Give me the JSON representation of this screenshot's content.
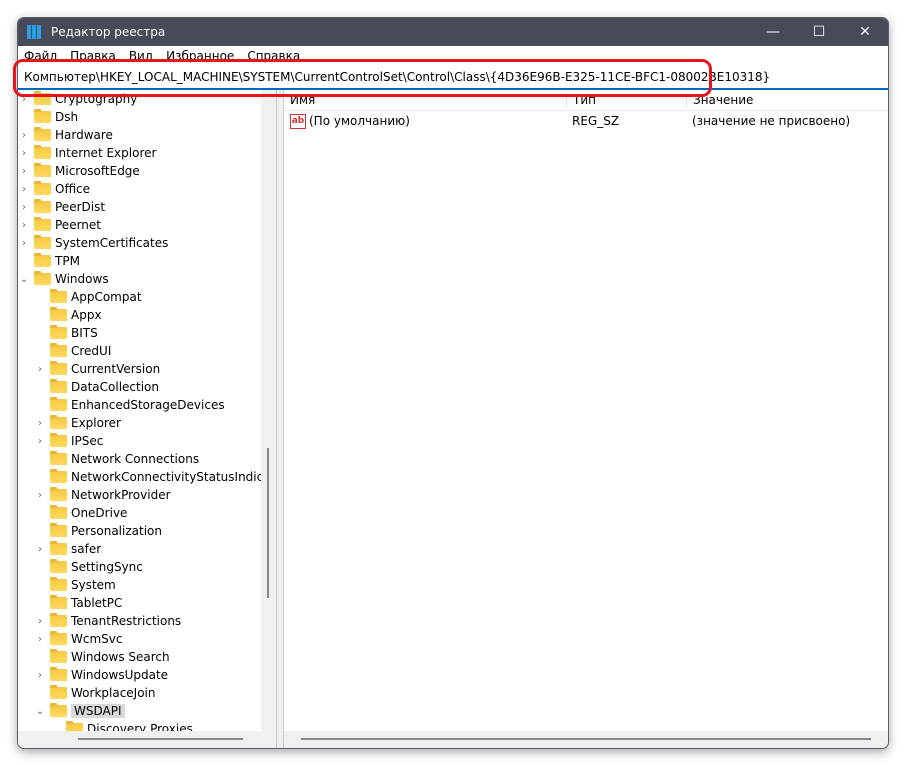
{
  "window": {
    "title": "Редактор реестра",
    "minimize": "—",
    "maximize": "☐",
    "close": "✕"
  },
  "menu": [
    "Файл",
    "Правка",
    "Вид",
    "Избранное",
    "Справка"
  ],
  "address": "Компьютер\\HKEY_LOCAL_MACHINE\\SYSTEM\\CurrentControlSet\\Control\\Class\\{4D36E96B-E325-11CE-BFC1-08002BE10318}",
  "tree": [
    {
      "label": "Cryptography",
      "level": 0,
      "expander": "collapsed"
    },
    {
      "label": "Dsh",
      "level": 0,
      "expander": "none"
    },
    {
      "label": "Hardware",
      "level": 0,
      "expander": "collapsed"
    },
    {
      "label": "Internet Explorer",
      "level": 0,
      "expander": "collapsed"
    },
    {
      "label": "MicrosoftEdge",
      "level": 0,
      "expander": "collapsed"
    },
    {
      "label": "Office",
      "level": 0,
      "expander": "collapsed"
    },
    {
      "label": "PeerDist",
      "level": 0,
      "expander": "collapsed"
    },
    {
      "label": "Peernet",
      "level": 0,
      "expander": "collapsed"
    },
    {
      "label": "SystemCertificates",
      "level": 0,
      "expander": "collapsed"
    },
    {
      "label": "TPM",
      "level": 0,
      "expander": "none"
    },
    {
      "label": "Windows",
      "level": 0,
      "expander": "expanded"
    },
    {
      "label": "AppCompat",
      "level": 1,
      "expander": "none"
    },
    {
      "label": "Appx",
      "level": 1,
      "expander": "none"
    },
    {
      "label": "BITS",
      "level": 1,
      "expander": "none"
    },
    {
      "label": "CredUI",
      "level": 1,
      "expander": "none"
    },
    {
      "label": "CurrentVersion",
      "level": 1,
      "expander": "collapsed"
    },
    {
      "label": "DataCollection",
      "level": 1,
      "expander": "none"
    },
    {
      "label": "EnhancedStorageDevices",
      "level": 1,
      "expander": "none"
    },
    {
      "label": "Explorer",
      "level": 1,
      "expander": "collapsed"
    },
    {
      "label": "IPSec",
      "level": 1,
      "expander": "collapsed"
    },
    {
      "label": "Network Connections",
      "level": 1,
      "expander": "none"
    },
    {
      "label": "NetworkConnectivityStatusIndicator",
      "level": 1,
      "expander": "none"
    },
    {
      "label": "NetworkProvider",
      "level": 1,
      "expander": "collapsed"
    },
    {
      "label": "OneDrive",
      "level": 1,
      "expander": "none"
    },
    {
      "label": "Personalization",
      "level": 1,
      "expander": "none"
    },
    {
      "label": "safer",
      "level": 1,
      "expander": "collapsed"
    },
    {
      "label": "SettingSync",
      "level": 1,
      "expander": "none"
    },
    {
      "label": "System",
      "level": 1,
      "expander": "none"
    },
    {
      "label": "TabletPC",
      "level": 1,
      "expander": "none"
    },
    {
      "label": "TenantRestrictions",
      "level": 1,
      "expander": "collapsed"
    },
    {
      "label": "WcmSvc",
      "level": 1,
      "expander": "collapsed"
    },
    {
      "label": "Windows Search",
      "level": 1,
      "expander": "none"
    },
    {
      "label": "WindowsUpdate",
      "level": 1,
      "expander": "collapsed"
    },
    {
      "label": "WorkplaceJoin",
      "level": 1,
      "expander": "none"
    },
    {
      "label": "WSDAPI",
      "level": 1,
      "expander": "expanded",
      "selected": true
    },
    {
      "label": "Discovery Proxies",
      "level": 2,
      "expander": "none"
    }
  ],
  "values": {
    "columns": [
      "Имя",
      "Тип",
      "Значение"
    ],
    "rows": [
      {
        "name": "(По умолчанию)",
        "type": "REG_SZ",
        "data": "(значение не присвоено)",
        "icon": "string-value-icon"
      }
    ]
  },
  "colors": {
    "titlebar": "#474b58",
    "highlight": "#e4161b",
    "accent": "#0067c0"
  }
}
